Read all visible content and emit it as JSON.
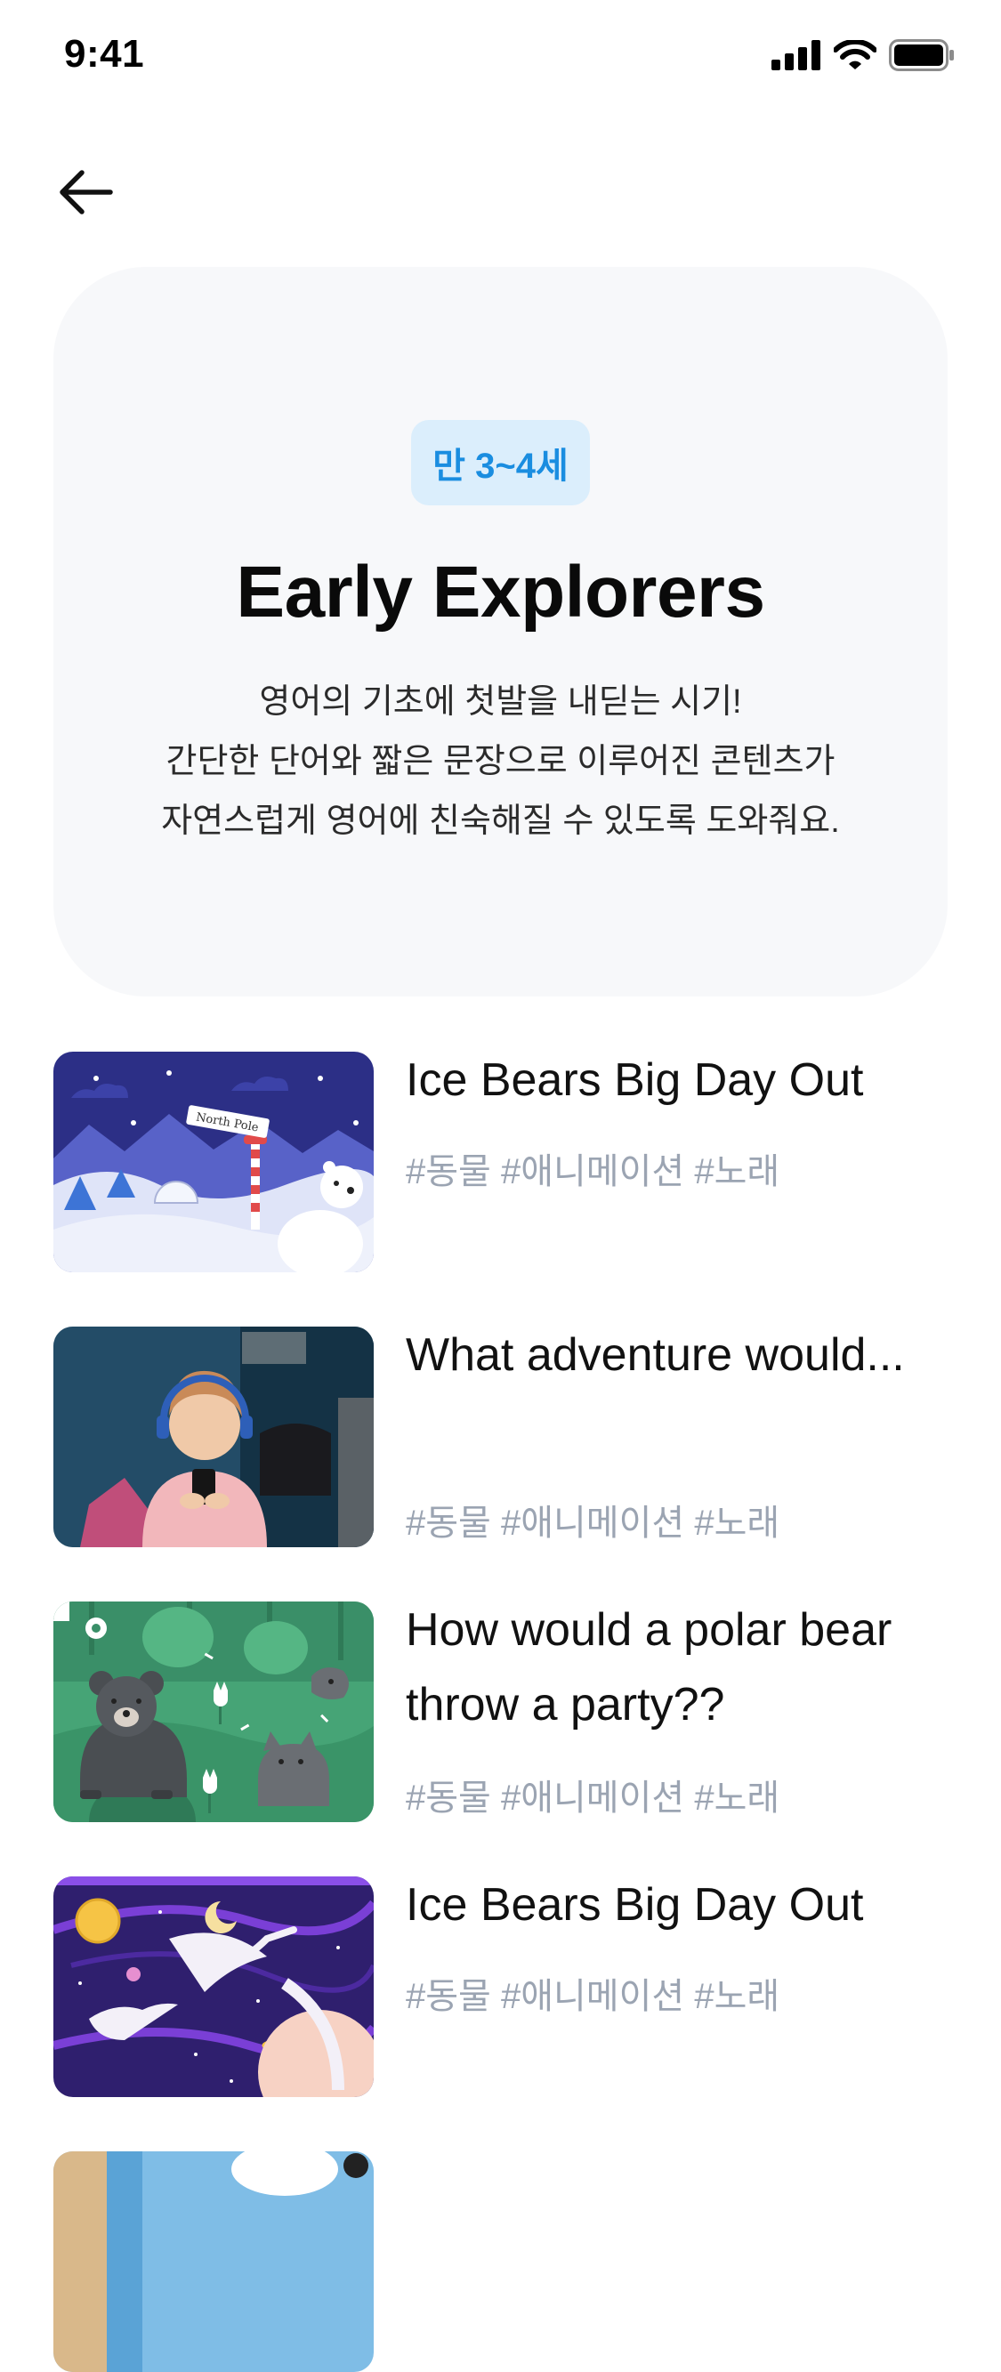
{
  "status_bar": {
    "time": "9:41"
  },
  "hero": {
    "age_badge": "만 3~4세",
    "title": "Early Explorers",
    "description": [
      "영어의 기초에 첫발을 내딛는 시기!",
      "간단한 단어와 짧은 문장으로 이루어진 콘텐츠가",
      "자연스럽게 영어에 친숙해질 수 있도록 도와줘요."
    ]
  },
  "videos": [
    {
      "title_lines": [
        "Ice Bears Big Day Out"
      ],
      "tags": "#동물 #애니메이션 #노래",
      "thumbnail_sign": "North Pole"
    },
    {
      "title_lines": [
        "What adventure would..."
      ],
      "tags": "#동물 #애니메이션 #노래"
    },
    {
      "title_lines": [
        "How would a polar bear",
        "throw a party??"
      ],
      "tags": "#동물 #애니메이션 #노래"
    },
    {
      "title_lines": [
        "Ice Bears Big Day Out"
      ],
      "tags": "#동물 #애니메이션 #노래"
    }
  ],
  "colors": {
    "badge_bg": "#dbeefc",
    "badge_text": "#1a8de0",
    "hero_bg": "#f7f8fa",
    "tag_text": "#9ba4b2"
  },
  "icons": [
    "signal-icon",
    "wifi-icon",
    "battery-icon",
    "back-arrow-icon"
  ]
}
